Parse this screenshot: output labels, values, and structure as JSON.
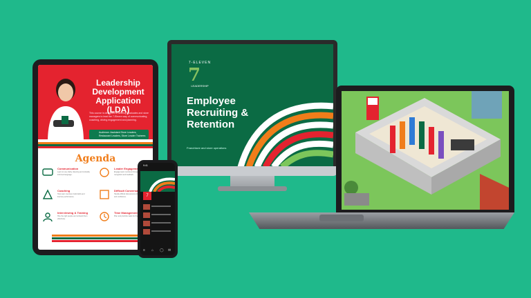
{
  "tablet": {
    "title": "Leadership Development Application (LDA)",
    "description": "This course is designed to develop graduates and store managers to lead the 7-Eleven way of communicating, coaching, driving engagement and planning.",
    "audience": "Audience: Assistant Store Leaders, Restaurant Leaders, Store Leader Trainees",
    "agenda_heading": "Agenda",
    "agenda_items": [
      {
        "heading": "Communication",
        "text": "Learn to use clarity, listening and culturally informed language."
      },
      {
        "heading": "Leader Engagement",
        "text": "Engage team members through recognition and feedback."
      },
      {
        "heading": "Coaching",
        "text": "Help team members build skills and improve performance."
      },
      {
        "heading": "Difficult Conversations",
        "text": "Handle difficult discussions with empathy and confidence."
      },
      {
        "heading": "Interviewing & Training",
        "text": "Hire the right people and onboard them effectively."
      },
      {
        "heading": "Time Management",
        "text": "Plan and prioritize tasks for the team."
      }
    ]
  },
  "monitor": {
    "badge_top": "7-ELEVEN",
    "badge_number": "7",
    "badge_bottom": "LEADERSHIP",
    "title": "Employee Recruiting & Retention",
    "footer": "Franchisee and store operations"
  },
  "phone": {
    "status_time": "9:41",
    "logo": "7",
    "nav": [
      "≡",
      "⌂",
      "◯",
      "✉"
    ]
  },
  "colors": {
    "background": "#1fb98b",
    "brand_green": "#0b6b44",
    "brand_red": "#e4232f",
    "brand_orange": "#f07d1a"
  }
}
